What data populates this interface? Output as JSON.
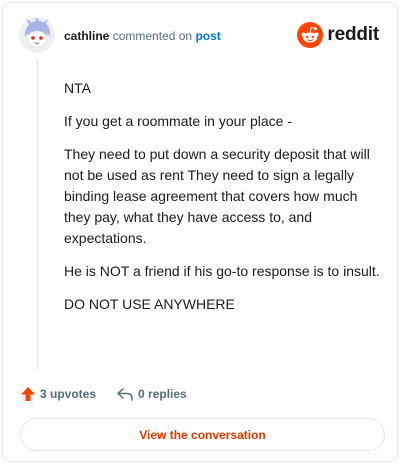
{
  "header": {
    "username": "cathline",
    "action_text": "commented on",
    "post_label": "post",
    "brand": "reddit"
  },
  "comment": {
    "paragraphs": [
      "NTA",
      "If you get a roommate in your place -",
      "They need to put down a security deposit that will not be used as rent They need to sign a legally binding lease agreement that covers how much they pay, what they have access to, and expectations.",
      "He is NOT a friend if his go-to response is to insult.",
      "DO NOT USE ANYWHERE"
    ]
  },
  "actions": {
    "upvotes_label": "3 upvotes",
    "replies_label": "0 replies"
  },
  "footer": {
    "view_button_label": "View the conversation"
  },
  "colors": {
    "brand_orange": "#ff4500",
    "link_blue": "#0079d3",
    "button_text": "#d93a00",
    "muted": "#576f76"
  },
  "icons": {
    "avatar": "snoo-avatar-icon",
    "logo": "reddit-logo-icon",
    "upvote": "upvote-arrow-icon",
    "reply": "reply-arrow-icon"
  }
}
